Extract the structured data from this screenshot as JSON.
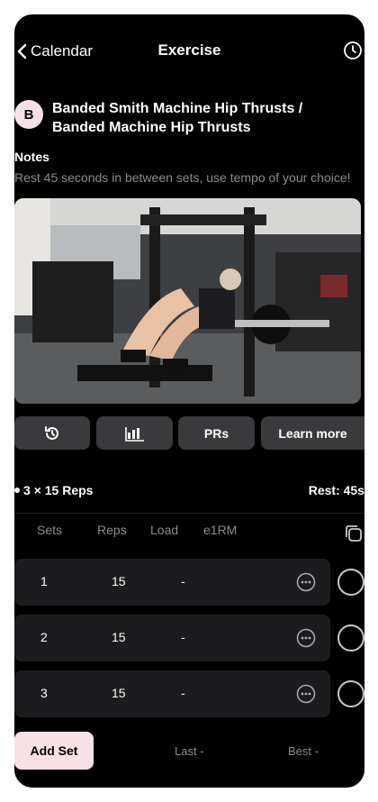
{
  "nav": {
    "back_label": "Calendar",
    "title": "Exercise",
    "history_icon": "clock-icon"
  },
  "exercise": {
    "badge": "B",
    "title": "Banded Smith Machine Hip Thrusts / Banded Machine Hip Thrusts",
    "notes_heading": "Notes",
    "notes_text": "Rest 45 seconds in between sets, use tempo of your choice!"
  },
  "toolbar": {
    "history_icon": "history-icon",
    "stats_icon": "bar-chart-icon",
    "prs_label": "PRs",
    "learn_label": "Learn more"
  },
  "scheme": {
    "reps": "3 × 15 Reps",
    "rest": "Rest: 45s"
  },
  "columns": {
    "sets": "Sets",
    "reps": "Reps",
    "load": "Load",
    "e1rm": "e1RM"
  },
  "sets": [
    {
      "set": "1",
      "reps": "15",
      "load": "-"
    },
    {
      "set": "2",
      "reps": "15",
      "load": "-"
    },
    {
      "set": "3",
      "reps": "15",
      "load": "-"
    }
  ],
  "footer": {
    "add_set_label": "Add Set",
    "last_label": "Last -",
    "best_label": "Best -"
  },
  "colors": {
    "background": "#000000",
    "accent": "#f8e1e6",
    "card": "#1c1c1e",
    "button": "#3a3a3c",
    "muted": "#8a8a8e"
  }
}
